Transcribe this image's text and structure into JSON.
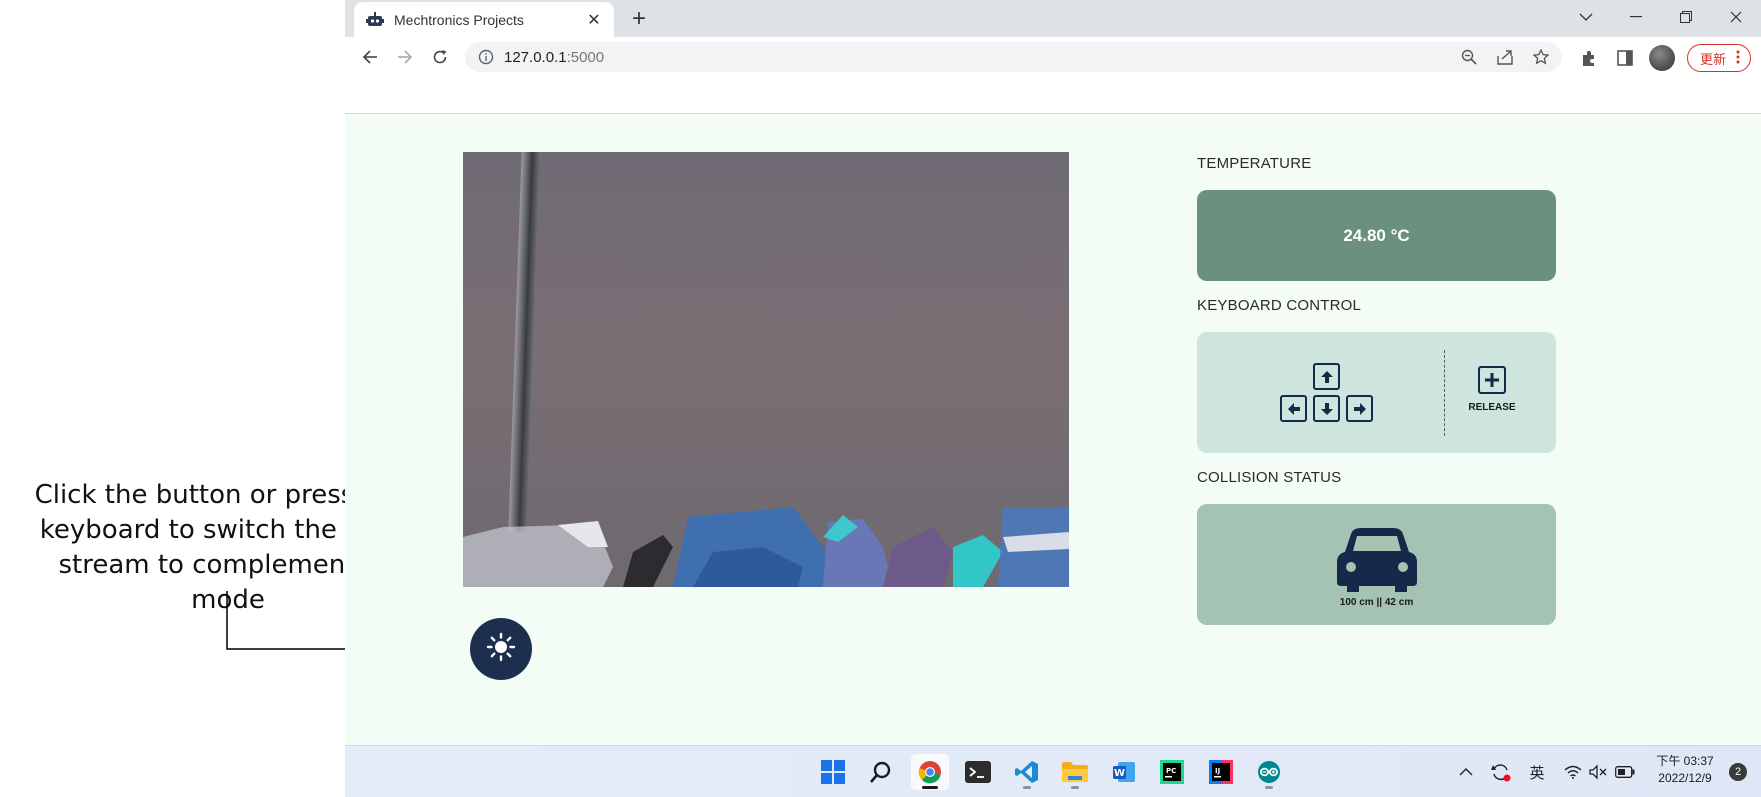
{
  "annotation": {
    "line1": "Click the button or press C on",
    "line2": "keyboard to switch the video",
    "line3": "stream to complementary mode"
  },
  "browser": {
    "tab_title": "Mechtronics Projects",
    "tab_icon": "robot-icon",
    "url_host": "127.0.0.1",
    "url_port": ":5000",
    "update_label": "更新"
  },
  "page": {
    "temperature_heading": "TEMPERATURE",
    "temperature_value": "24.80 °C",
    "keyboard_heading": "KEYBOARD CONTROL",
    "release_label": "RELEASE",
    "collision_heading": "COLLISION STATUS",
    "collision_value": "100 cm || 42 cm",
    "light_button_icon": "sun-icon"
  },
  "taskbar": {
    "apps": [
      "windows-start",
      "search",
      "chrome",
      "terminal",
      "vscode",
      "file-explorer",
      "word",
      "pycharm",
      "intellij",
      "arduino"
    ],
    "ime": "英",
    "time": "下午 03:37",
    "date": "2022/12/9",
    "notifications": "2"
  },
  "colors": {
    "page_bg": "#f3fcf5",
    "temp_card": "#6b9080",
    "keyboard_card": "#cde4df",
    "collision_card": "#a4c3b2",
    "dark_navy": "#15294a",
    "update_red": "#d93025"
  }
}
